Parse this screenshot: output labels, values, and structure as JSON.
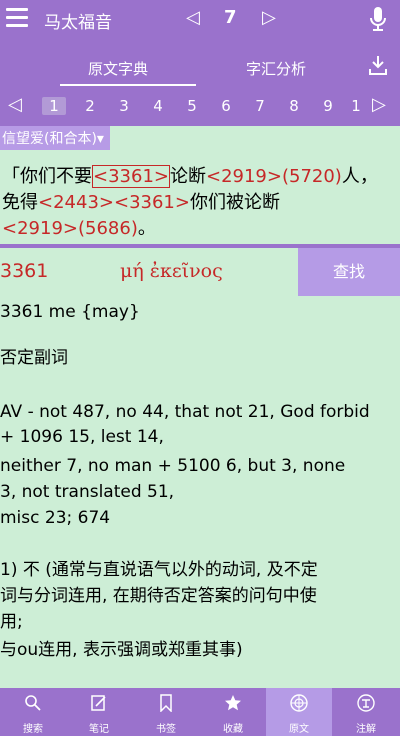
{
  "header": {
    "title": "马太福音",
    "prev": "◁",
    "chapter": "7",
    "next": "▷"
  },
  "tabs": [
    {
      "label": "原文字典"
    },
    {
      "label": "字汇分析"
    }
  ],
  "verse_nav": {
    "prev": "◁",
    "next": "▷",
    "numbers": [
      "1",
      "2",
      "3",
      "4",
      "5",
      "6",
      "7",
      "8",
      "9",
      "1"
    ],
    "active": "1"
  },
  "version": "信望爱(和合本)▾",
  "verse": {
    "p1": "「你们不要",
    "s1": "<3361>",
    "p2": "论断",
    "s2": "<2919>",
    "s3": "(5720)",
    "p3": "人，",
    "p4": "免得",
    "s4": "<2443>",
    "s5": "<3361>",
    "p5": "你们被论断",
    "s6": "<2919>",
    "s7": "(5686)",
    "p6": "。"
  },
  "lexicon": {
    "number": "3361",
    "greek": "μή ἐκεῖνος",
    "find": "查找",
    "lines": [
      "3361 me {may}",
      "",
      "否定副词",
      "",
      "AV - not 487, no 44, that not 21, God forbid",
      "+ 1096 15, lest 14,",
      "     neither 7, no man + 5100 6, but 3, none",
      "3, not translated 51,",
      "     misc 23; 674",
      "",
      "1) 不 (通常与直说语气以外的动词, 及不定",
      "词与分词连用, 在期待否定答案的问句中使",
      "用;",
      "     与ou连用, 表示强调或郑重其事)"
    ]
  },
  "bottom_nav": [
    {
      "label": "搜索",
      "icon": "search-icon"
    },
    {
      "label": "笔记",
      "icon": "note-icon"
    },
    {
      "label": "书签",
      "icon": "bookmark-icon"
    },
    {
      "label": "收藏",
      "icon": "star-icon"
    },
    {
      "label": "原文",
      "icon": "original-text-icon"
    },
    {
      "label": "注解",
      "icon": "annotation-icon"
    }
  ],
  "colors": {
    "primary": "#9a72cc",
    "background": "#cdeed6",
    "strongs_red": "#c62828"
  }
}
